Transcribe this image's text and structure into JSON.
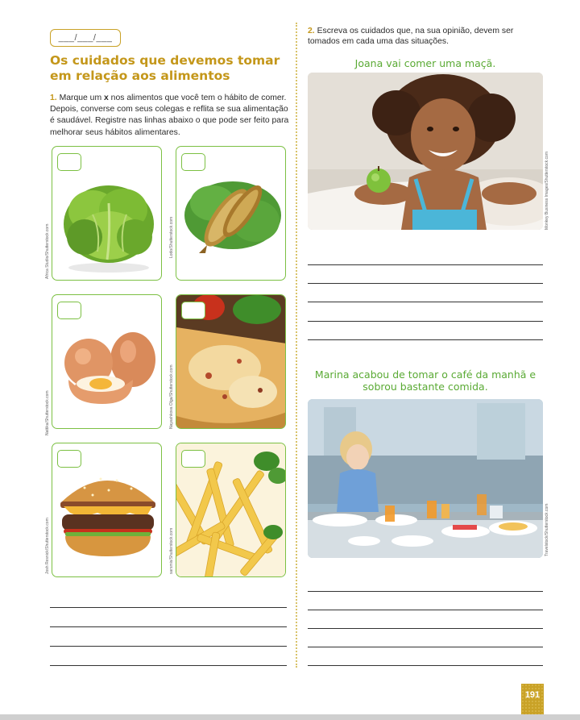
{
  "header": {
    "date_placeholder": "___/___/___"
  },
  "left": {
    "title": "Os cuidados que devemos tomar em relação aos alimentos",
    "question1": {
      "number": "1.",
      "text_before": "Marque um ",
      "mark": "x",
      "text_after": " nos alimentos que você tem o hábito de comer. Depois, converse com seus colegas e reflita se sua alimentação é saudável. Registre nas linhas abaixo o que pode ser feito para melhorar seus hábitos alimentares."
    },
    "foods": [
      {
        "name": "alface",
        "credit": "Africa Studio/Shutterstock.com"
      },
      {
        "name": "peixe",
        "credit": "Lodo/Shutterstock.com"
      },
      {
        "name": "ovos",
        "credit": "Nattika/Shutterstock.com"
      },
      {
        "name": "pizza",
        "credit": "Nayashkova Olga/Shutterstock.com"
      },
      {
        "name": "hambúrguer",
        "credit": "Josh Resnick/Shutterstock.com"
      },
      {
        "name": "batata frita",
        "credit": "sarsmis/Shutterstock.com"
      }
    ]
  },
  "right": {
    "question2": {
      "number": "2.",
      "text": "Escreva os cuidados que, na sua opinião, devem ser tomados em cada uma das situações."
    },
    "scenario1": {
      "title": "Joana vai comer uma maçã.",
      "credit": "Monkey Business Images/Shutterstock.com"
    },
    "scenario2": {
      "title": "Marina acabou de tomar o café da manhã e sobrou bastante comida.",
      "credit": "Travelstock/Shutterstock.com"
    }
  },
  "footer": {
    "page_number": "191"
  },
  "colors": {
    "gold": "#c4971a",
    "green": "#5aaa34",
    "card_border": "#7cc043"
  }
}
